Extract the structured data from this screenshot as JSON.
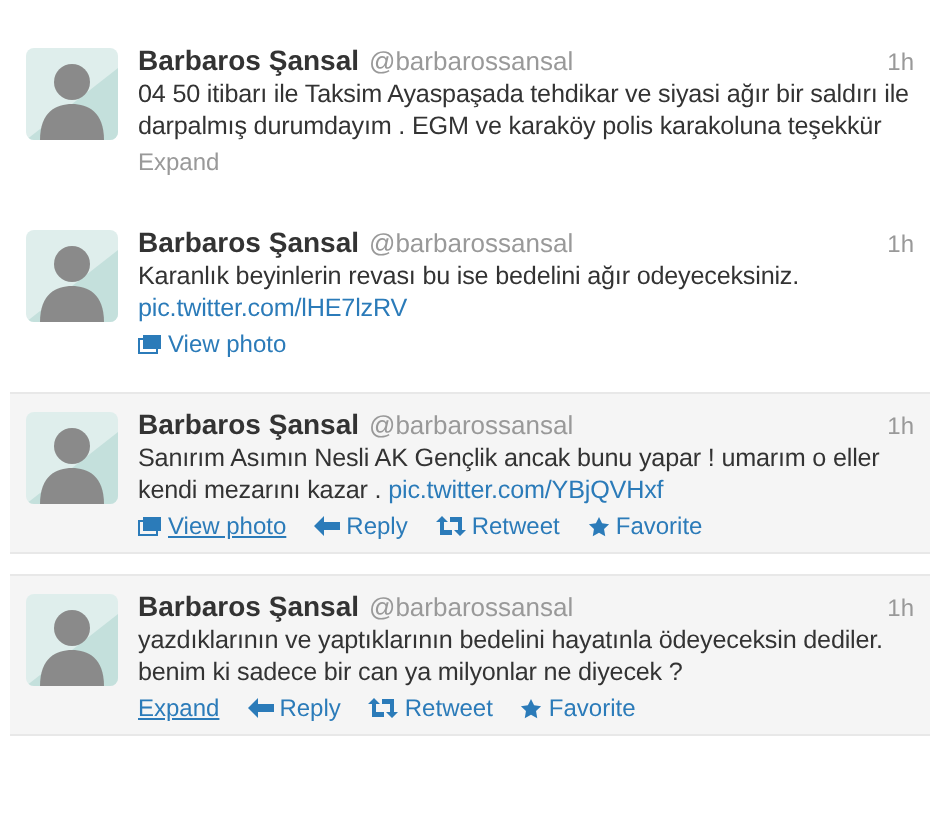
{
  "tweets": [
    {
      "name": "Barbaros Şansal",
      "handle": "@barbarossansal",
      "time": "1h",
      "text": "04 50 itibarı ile Taksim Ayaspaşada tehdikar ve siyasi ağır bir saldırı ile darpalmış durumdayım . EGM ve karaköy polis karakoluna teşekkür",
      "highlighted": false,
      "actions": [
        {
          "kind": "expand",
          "label": "Expand"
        }
      ]
    },
    {
      "name": "Barbaros Şansal",
      "handle": "@barbarossansal",
      "time": "1h",
      "text": "Karanlık beyinlerin revası bu ise bedelini ağır odeyeceksiniz.",
      "link": "pic.twitter.com/lHE7lzRV",
      "highlighted": false,
      "actions": [
        {
          "kind": "view_photo",
          "label": "View photo"
        }
      ]
    },
    {
      "name": "Barbaros Şansal",
      "handle": "@barbarossansal",
      "time": "1h",
      "text": "Sanırım Asımın Nesli AK Gençlik ancak bunu yapar ! umarım o eller kendi mezarını kazar .",
      "link": "pic.twitter.com/YBjQVHxf",
      "highlighted": true,
      "actions": [
        {
          "kind": "view_photo",
          "label": "View photo"
        },
        {
          "kind": "reply",
          "label": "Reply"
        },
        {
          "kind": "retweet",
          "label": "Retweet"
        },
        {
          "kind": "favorite",
          "label": "Favorite"
        }
      ]
    },
    {
      "name": "Barbaros Şansal",
      "handle": "@barbarossansal",
      "time": "1h",
      "text": "yazdıklarının ve yaptıklarının bedelini hayatınla ödeyeceksin dediler. benim ki sadece bir can ya milyonlar ne diyecek ?",
      "highlighted": true,
      "actions": [
        {
          "kind": "expand",
          "label": "Expand"
        },
        {
          "kind": "reply",
          "label": "Reply"
        },
        {
          "kind": "retweet",
          "label": "Retweet"
        },
        {
          "kind": "favorite",
          "label": "Favorite"
        }
      ]
    }
  ]
}
